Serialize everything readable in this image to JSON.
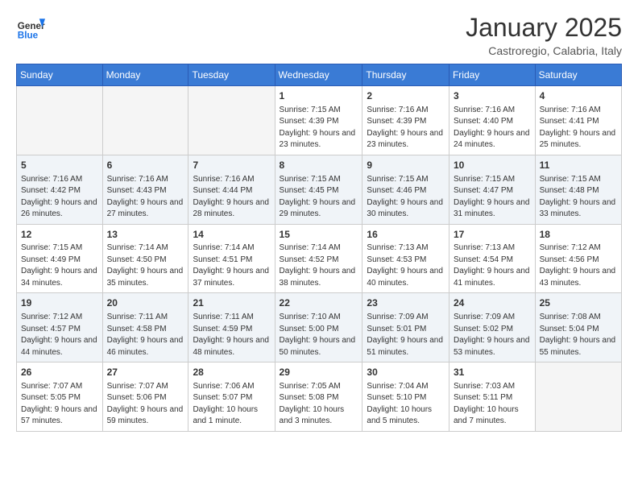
{
  "header": {
    "logo_line1": "General",
    "logo_line2": "Blue",
    "month": "January 2025",
    "location": "Castroregio, Calabria, Italy"
  },
  "weekdays": [
    "Sunday",
    "Monday",
    "Tuesday",
    "Wednesday",
    "Thursday",
    "Friday",
    "Saturday"
  ],
  "weeks": [
    [
      {
        "day": "",
        "info": ""
      },
      {
        "day": "",
        "info": ""
      },
      {
        "day": "",
        "info": ""
      },
      {
        "day": "1",
        "info": "Sunrise: 7:15 AM\nSunset: 4:39 PM\nDaylight: 9 hours and 23 minutes."
      },
      {
        "day": "2",
        "info": "Sunrise: 7:16 AM\nSunset: 4:39 PM\nDaylight: 9 hours and 23 minutes."
      },
      {
        "day": "3",
        "info": "Sunrise: 7:16 AM\nSunset: 4:40 PM\nDaylight: 9 hours and 24 minutes."
      },
      {
        "day": "4",
        "info": "Sunrise: 7:16 AM\nSunset: 4:41 PM\nDaylight: 9 hours and 25 minutes."
      }
    ],
    [
      {
        "day": "5",
        "info": "Sunrise: 7:16 AM\nSunset: 4:42 PM\nDaylight: 9 hours and 26 minutes."
      },
      {
        "day": "6",
        "info": "Sunrise: 7:16 AM\nSunset: 4:43 PM\nDaylight: 9 hours and 27 minutes."
      },
      {
        "day": "7",
        "info": "Sunrise: 7:16 AM\nSunset: 4:44 PM\nDaylight: 9 hours and 28 minutes."
      },
      {
        "day": "8",
        "info": "Sunrise: 7:15 AM\nSunset: 4:45 PM\nDaylight: 9 hours and 29 minutes."
      },
      {
        "day": "9",
        "info": "Sunrise: 7:15 AM\nSunset: 4:46 PM\nDaylight: 9 hours and 30 minutes."
      },
      {
        "day": "10",
        "info": "Sunrise: 7:15 AM\nSunset: 4:47 PM\nDaylight: 9 hours and 31 minutes."
      },
      {
        "day": "11",
        "info": "Sunrise: 7:15 AM\nSunset: 4:48 PM\nDaylight: 9 hours and 33 minutes."
      }
    ],
    [
      {
        "day": "12",
        "info": "Sunrise: 7:15 AM\nSunset: 4:49 PM\nDaylight: 9 hours and 34 minutes."
      },
      {
        "day": "13",
        "info": "Sunrise: 7:14 AM\nSunset: 4:50 PM\nDaylight: 9 hours and 35 minutes."
      },
      {
        "day": "14",
        "info": "Sunrise: 7:14 AM\nSunset: 4:51 PM\nDaylight: 9 hours and 37 minutes."
      },
      {
        "day": "15",
        "info": "Sunrise: 7:14 AM\nSunset: 4:52 PM\nDaylight: 9 hours and 38 minutes."
      },
      {
        "day": "16",
        "info": "Sunrise: 7:13 AM\nSunset: 4:53 PM\nDaylight: 9 hours and 40 minutes."
      },
      {
        "day": "17",
        "info": "Sunrise: 7:13 AM\nSunset: 4:54 PM\nDaylight: 9 hours and 41 minutes."
      },
      {
        "day": "18",
        "info": "Sunrise: 7:12 AM\nSunset: 4:56 PM\nDaylight: 9 hours and 43 minutes."
      }
    ],
    [
      {
        "day": "19",
        "info": "Sunrise: 7:12 AM\nSunset: 4:57 PM\nDaylight: 9 hours and 44 minutes."
      },
      {
        "day": "20",
        "info": "Sunrise: 7:11 AM\nSunset: 4:58 PM\nDaylight: 9 hours and 46 minutes."
      },
      {
        "day": "21",
        "info": "Sunrise: 7:11 AM\nSunset: 4:59 PM\nDaylight: 9 hours and 48 minutes."
      },
      {
        "day": "22",
        "info": "Sunrise: 7:10 AM\nSunset: 5:00 PM\nDaylight: 9 hours and 50 minutes."
      },
      {
        "day": "23",
        "info": "Sunrise: 7:09 AM\nSunset: 5:01 PM\nDaylight: 9 hours and 51 minutes."
      },
      {
        "day": "24",
        "info": "Sunrise: 7:09 AM\nSunset: 5:02 PM\nDaylight: 9 hours and 53 minutes."
      },
      {
        "day": "25",
        "info": "Sunrise: 7:08 AM\nSunset: 5:04 PM\nDaylight: 9 hours and 55 minutes."
      }
    ],
    [
      {
        "day": "26",
        "info": "Sunrise: 7:07 AM\nSunset: 5:05 PM\nDaylight: 9 hours and 57 minutes."
      },
      {
        "day": "27",
        "info": "Sunrise: 7:07 AM\nSunset: 5:06 PM\nDaylight: 9 hours and 59 minutes."
      },
      {
        "day": "28",
        "info": "Sunrise: 7:06 AM\nSunset: 5:07 PM\nDaylight: 10 hours and 1 minute."
      },
      {
        "day": "29",
        "info": "Sunrise: 7:05 AM\nSunset: 5:08 PM\nDaylight: 10 hours and 3 minutes."
      },
      {
        "day": "30",
        "info": "Sunrise: 7:04 AM\nSunset: 5:10 PM\nDaylight: 10 hours and 5 minutes."
      },
      {
        "day": "31",
        "info": "Sunrise: 7:03 AM\nSunset: 5:11 PM\nDaylight: 10 hours and 7 minutes."
      },
      {
        "day": "",
        "info": ""
      }
    ]
  ]
}
